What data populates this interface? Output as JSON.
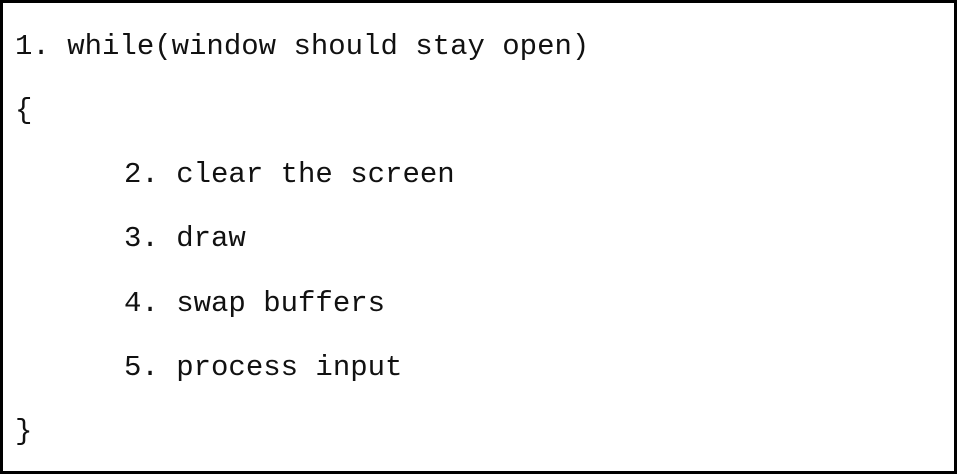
{
  "code": {
    "lines": [
      "1. while(window should stay open)",
      "{",
      "2. clear the screen",
      "3. draw",
      "4. swap buffers",
      "5. process input",
      "}"
    ]
  }
}
